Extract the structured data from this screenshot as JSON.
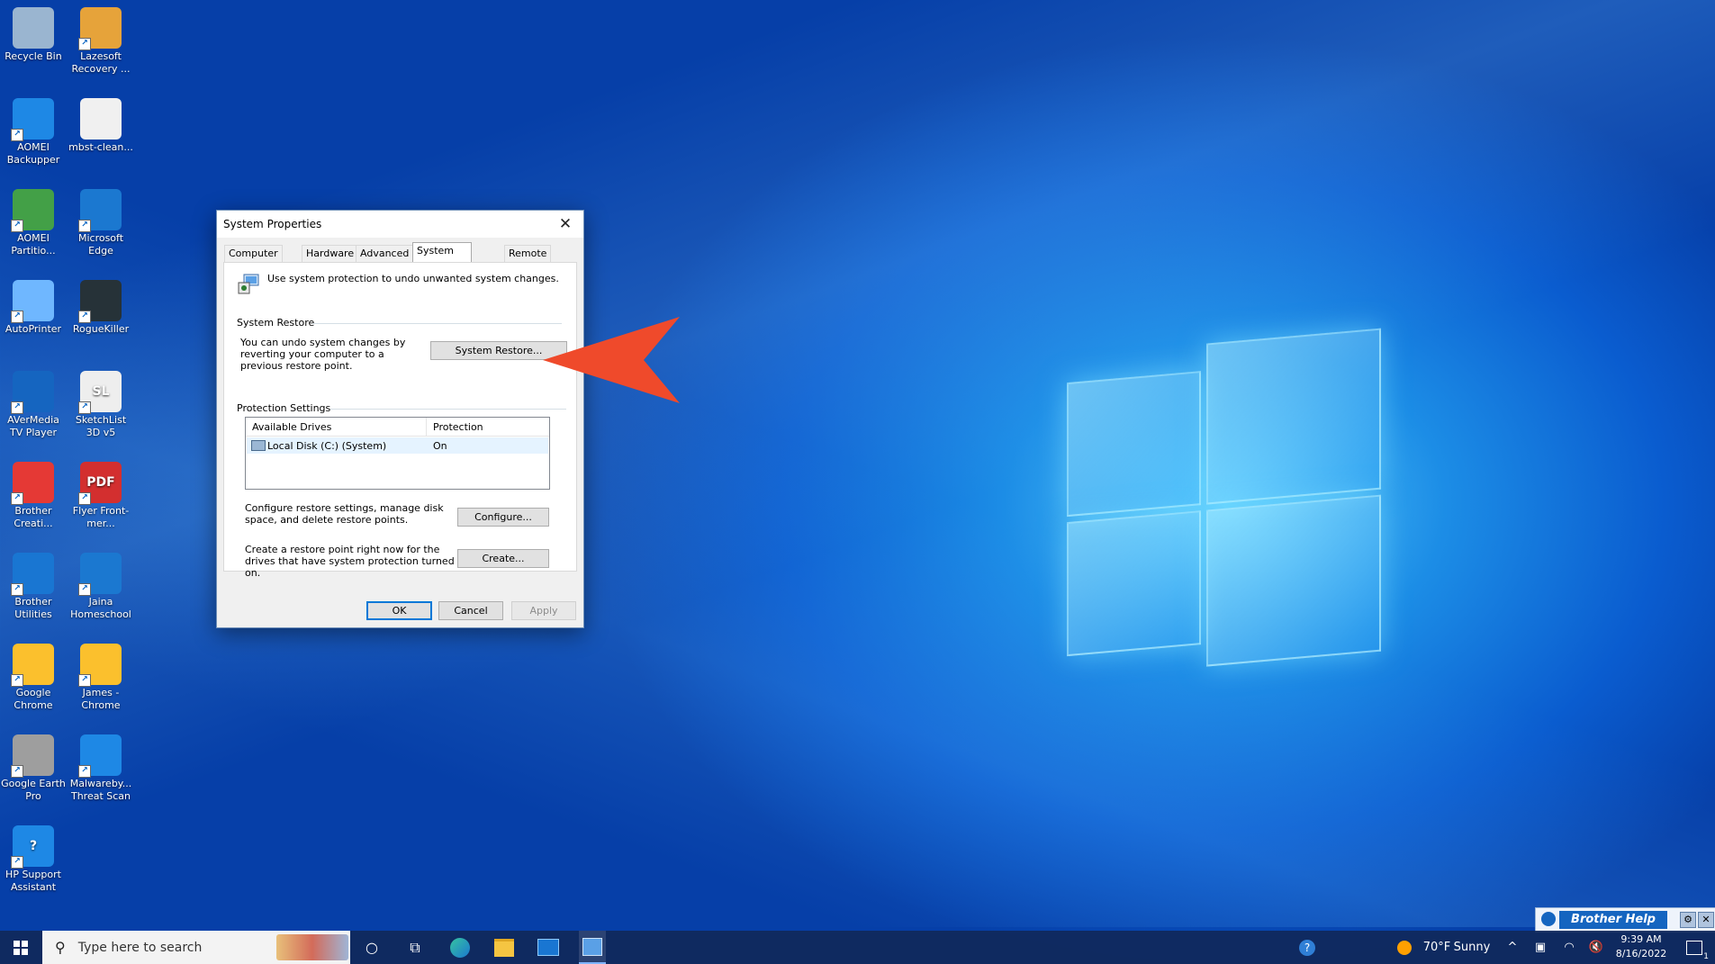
{
  "desktop": {
    "icons": [
      {
        "label": "Recycle Bin",
        "icon": "recycle-bin-icon"
      },
      {
        "label": "Lazesoft Recovery ...",
        "icon": "lazesoft-icon"
      },
      {
        "label": "AOMEI Backupper",
        "icon": "aomei-backupper-icon"
      },
      {
        "label": "mbst-clean...",
        "icon": "text-file-icon"
      },
      {
        "label": "AOMEI Partitio...",
        "icon": "aomei-partition-icon"
      },
      {
        "label": "Microsoft Edge",
        "icon": "edge-icon"
      },
      {
        "label": "AutoPrinter",
        "icon": "autoprinter-icon"
      },
      {
        "label": "RogueKiller",
        "icon": "roguekiller-icon"
      },
      {
        "label": "AVerMedia TV Player",
        "icon": "avermedia-icon"
      },
      {
        "label": "SketchList 3D v5",
        "icon": "sketchlist-icon",
        "badge": "SL"
      },
      {
        "label": "Brother Creati...",
        "icon": "brother-creative-icon"
      },
      {
        "label": "Flyer Front-mer...",
        "icon": "pdf-icon",
        "badge": "PDF"
      },
      {
        "label": "Brother Utilities",
        "icon": "brother-utilities-icon"
      },
      {
        "label": "Jaina Homeschool",
        "icon": "edge-icon"
      },
      {
        "label": "Google Chrome",
        "icon": "chrome-icon"
      },
      {
        "label": "James - Chrome",
        "icon": "chrome-icon"
      },
      {
        "label": "Google Earth Pro",
        "icon": "google-earth-icon"
      },
      {
        "label": "Malwareby... Threat Scan",
        "icon": "malwarebytes-icon"
      },
      {
        "label": "HP Support Assistant",
        "icon": "help-icon",
        "badge": "?"
      }
    ]
  },
  "dialog": {
    "title": "System Properties",
    "close": "✕",
    "tabs": [
      {
        "label": "Computer Name"
      },
      {
        "label": "Hardware"
      },
      {
        "label": "Advanced"
      },
      {
        "label": "System Protection",
        "active": true
      },
      {
        "label": "Remote"
      }
    ],
    "intro": "Use system protection to undo unwanted system changes.",
    "system_restore": {
      "group_label": "System Restore",
      "description": "You can undo system changes by reverting your computer to a previous restore point.",
      "button": "System Restore..."
    },
    "protection_settings": {
      "group_label": "Protection Settings",
      "columns": [
        "Available Drives",
        "Protection"
      ],
      "rows": [
        {
          "drive": "Local Disk (C:) (System)",
          "protection": "On"
        }
      ],
      "configure_text": "Configure restore settings, manage disk space, and delete restore points.",
      "configure_button": "Configure...",
      "create_text": "Create a restore point right now for the drives that have system protection turned on.",
      "create_button": "Create..."
    },
    "buttons": {
      "ok": "OK",
      "cancel": "Cancel",
      "apply": "Apply"
    }
  },
  "annotation": {
    "color": "#ef4a2b"
  },
  "brother_help": {
    "label": "Brother Help"
  },
  "taskbar": {
    "search_placeholder": "Type here to search",
    "weather": "70°F",
    "weather_text": "Sunny",
    "time": "9:39 AM",
    "date": "8/16/2022",
    "notification_count": "1"
  }
}
